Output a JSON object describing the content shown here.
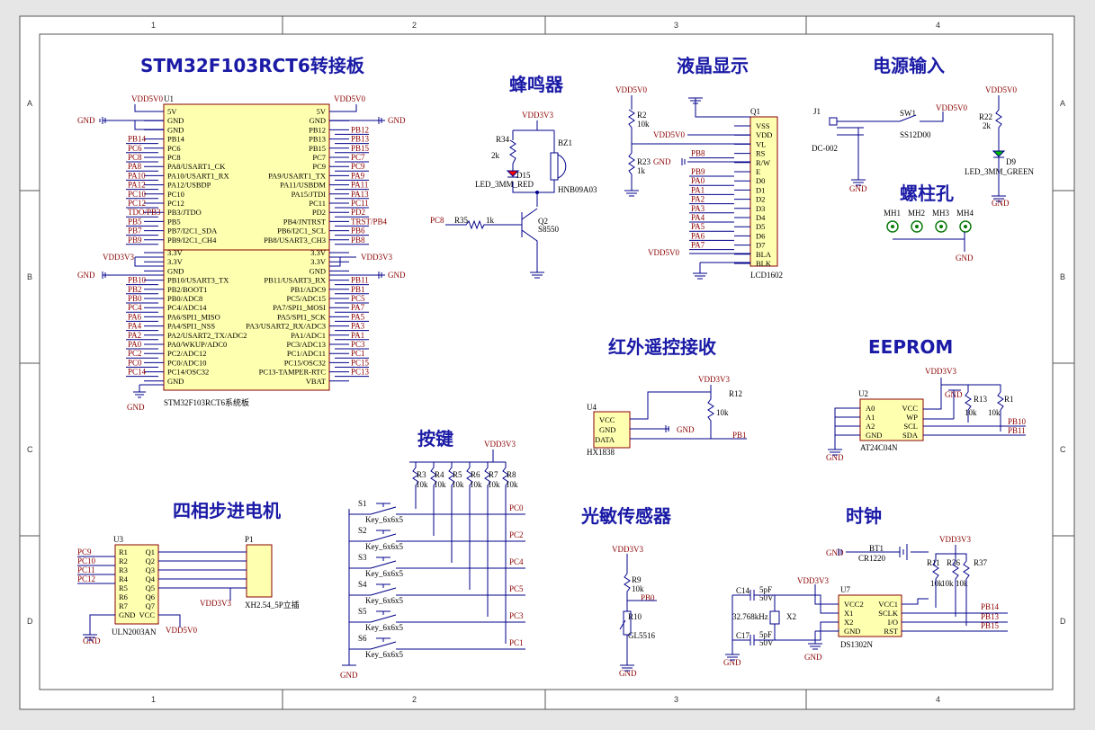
{
  "frame": {
    "cols": [
      "1",
      "2",
      "3",
      "4"
    ],
    "rows": [
      "A",
      "B",
      "C",
      "D"
    ]
  },
  "titles": {
    "mcu": "STM32F103RCT6转接板",
    "buzzer": "蜂鸣器",
    "lcd": "液晶显示",
    "power": "电源输入",
    "screw": "螺柱孔",
    "ir": "红外遥控接收",
    "eeprom": "EEPROM",
    "keys": "按键",
    "stepper": "四相步进电机",
    "ldr": "光敏传感器",
    "clock": "时钟"
  },
  "u1": {
    "ref": "U1",
    "name": "STM32F103RCT6系统板",
    "left_pins": [
      "5V",
      "GND",
      "GND",
      "PB14",
      "PC6",
      "PC8",
      "PA8/USART1_CK",
      "PA10/USART1_RX",
      "PA12/USBDP",
      "PC10",
      "PC12",
      "PB3/JTDO",
      "PB5",
      "PB7/I2C1_SDA",
      "PB9/I2C1_CH4",
      "3.3V",
      "3.3V",
      "GND",
      "PB10/USART3_TX",
      "PB2/BOOT1",
      "PB0/ADC8",
      "PC4/ADC14",
      "PA6/SPI1_MISO",
      "PA4/SPI1_NSS",
      "PA2/USART2_TX/ADC2",
      "PA0/WKUP/ADC0",
      "PC2/ADC12",
      "PC0/ADC10",
      "PC14/OSC32",
      "GND"
    ],
    "right_pins": [
      "5V",
      "GND",
      "PB12",
      "PB13",
      "PB15",
      "PC7",
      "PC9",
      "PA9/USART1_TX",
      "PA11/USBDM",
      "PA15/JTDI",
      "PC11",
      "PD2",
      "PB4/JNTRST",
      "PB6/I2C1_SCL",
      "PB8/USART3_CH3",
      "3.3V",
      "3.3V",
      "GND",
      "PB11/USART3_RX",
      "PB1/ADC9",
      "PC5/ADC15",
      "PA7/SPI1_MOSI",
      "PA5/SPI1_SCK",
      "PA3/USART2_RX/ADC3",
      "PA1/ADC1",
      "PC3/ADC13",
      "PC1/ADC11",
      "PC15/OSC32",
      "PC13-TAMPER-RTC",
      "VBAT"
    ],
    "left_nets": [
      "",
      "",
      "",
      "PB14",
      "PC6",
      "PC8",
      "PA8",
      "PA10",
      "PA12",
      "PC10",
      "PC12",
      "TDO/PB3",
      "PB5",
      "PB7",
      "PB9",
      "",
      "",
      "",
      "PB10",
      "PB2",
      "PB0",
      "PC4",
      "PA6",
      "PA4",
      "PA2",
      "PA0",
      "PC2",
      "PC0",
      "PC14",
      ""
    ],
    "right_nets": [
      "",
      "",
      "PB12",
      "PB13",
      "PB15",
      "PC7",
      "PC9",
      "PA9",
      "PA11",
      "PA13",
      "PC11",
      "PD2",
      "TRST/PB4",
      "PB6",
      "PB8",
      "",
      "",
      "",
      "PB11",
      "PB1",
      "PC5",
      "PA7",
      "PA5",
      "PA3",
      "PA1",
      "PC3",
      "PC1",
      "PC15",
      "PC13",
      ""
    ]
  },
  "nets": {
    "vdd5": "VDD5V0",
    "vdd33": "VDD3V3",
    "gnd": "GND"
  },
  "buzzer": {
    "r": "R34",
    "rv": "2k",
    "d": "D15",
    "dv": "LED_3MM_RED",
    "bz": "BZ1",
    "bzv": "HNB09A03",
    "q": "Q2",
    "qv": "S8550",
    "rb": "R35",
    "rbv": "1k",
    "net": "PC8"
  },
  "lcd": {
    "ref": "Q1",
    "name": "LCD1602",
    "r2": "R2",
    "r2v": "10k",
    "r23": "R23",
    "r23v": "1k",
    "pins": [
      "VSS",
      "VDD",
      "VL",
      "RS",
      "R/W",
      "E",
      "D0",
      "D1",
      "D2",
      "D3",
      "D4",
      "D5",
      "D6",
      "D7",
      "BLA",
      "BLK"
    ],
    "nets": [
      "",
      "",
      "",
      "PB8",
      "",
      "PB9",
      "PA0",
      "PA1",
      "PA2",
      "PA3",
      "PA4",
      "PA5",
      "PA6",
      "PA7",
      "",
      ""
    ]
  },
  "power": {
    "j": "J1",
    "jv": "DC-002",
    "sw": "SW1",
    "swv": "SS12D00",
    "r": "R22",
    "rv": "2k",
    "d": "D9",
    "dv": "LED_3MM_GREEN"
  },
  "screw": [
    "MH1",
    "MH2",
    "MH3",
    "MH4"
  ],
  "ir": {
    "ref": "U4",
    "name": "HX1838",
    "pins": [
      "VCC",
      "GND",
      "DATA"
    ],
    "r": "R12",
    "rv": "10k",
    "net": "PB1"
  },
  "eeprom": {
    "ref": "U2",
    "name": "AT24C04N",
    "lp": [
      "A0",
      "A1",
      "A2",
      "GND"
    ],
    "rp": [
      "VCC",
      "WP",
      "SCL",
      "SDA"
    ],
    "r1": "R13",
    "r2": "R1",
    "rv": "10k",
    "n1": "PB10",
    "n2": "PB11"
  },
  "keys": {
    "sw": [
      "S1",
      "S2",
      "S3",
      "S4",
      "S5",
      "S6"
    ],
    "val": "Key_6x6x5",
    "r": [
      "R3",
      "R4",
      "R5",
      "R6",
      "R7",
      "R8"
    ],
    "rv": "10k",
    "nets": [
      "PC0",
      "PC2",
      "PC4",
      "PC5",
      "PC3",
      "PC1"
    ]
  },
  "stepper": {
    "ref": "U3",
    "name": "ULN2003AN",
    "lp": [
      "R1",
      "R2",
      "R3",
      "R4",
      "R5",
      "R6",
      "R7",
      "GND"
    ],
    "rp": [
      "Q1",
      "Q2",
      "Q3",
      "Q4",
      "Q5",
      "Q6",
      "Q7",
      "VCC"
    ],
    "nets": [
      "PC9",
      "PC10",
      "PC11",
      "PC12"
    ],
    "p": "P1",
    "pv": "XH2.54_5P立插"
  },
  "ldr": {
    "r": "R9",
    "rv": "10k",
    "r10": "R10",
    "r10v": "GL5516",
    "net": "PB0"
  },
  "clock": {
    "bt": "BT1",
    "btv": "CR1220",
    "c1": "C14",
    "c2": "C17",
    "cv": "5pF",
    "cv2": "50V",
    "x": "X2",
    "xv": "32.768kHz",
    "u": "U7",
    "uv": "DS1302N",
    "lp": [
      "VCC2",
      "X1",
      "X2",
      "GND"
    ],
    "rp": [
      "VCC1",
      "SCLK",
      "I/O",
      "RST"
    ],
    "rs": [
      "R11",
      "R36",
      "R37"
    ],
    "rv": "10k",
    "nets": [
      "PB14",
      "PB13",
      "PB15"
    ]
  }
}
